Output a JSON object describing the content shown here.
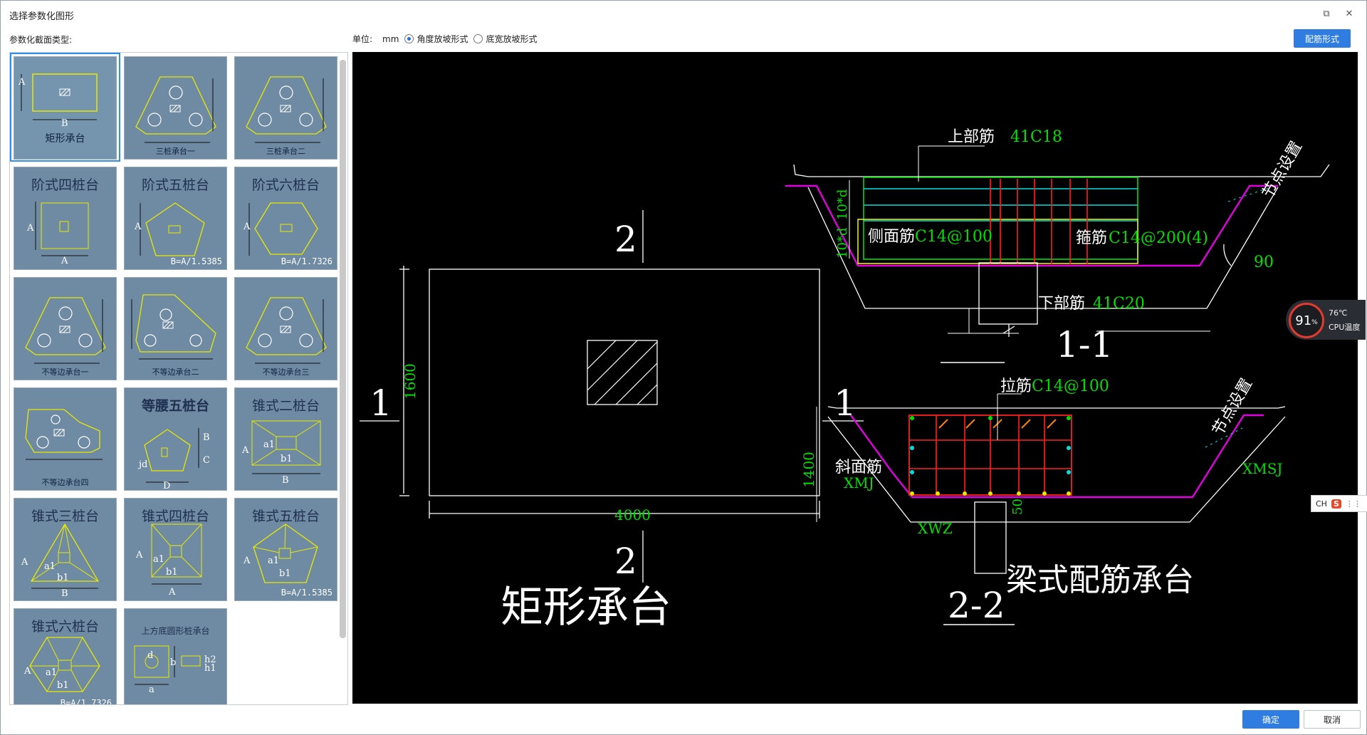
{
  "window": {
    "title": "选择参数化图形",
    "restore_icon": "restore-icon",
    "close_icon": "close-icon"
  },
  "library": {
    "label": "参数化截面类型:",
    "items": [
      {
        "name": "矩形承台",
        "selected": true
      },
      {
        "name": "三桩承台一"
      },
      {
        "name": "三桩承台二"
      },
      {
        "name": "阶式四桩台"
      },
      {
        "name": "阶式五桩台",
        "note": "B=A/1.5385"
      },
      {
        "name": "阶式六桩台",
        "note": "B=A/1.7326"
      },
      {
        "name": "不等边承台一"
      },
      {
        "name": "不等边承台二"
      },
      {
        "name": "不等边承台三"
      },
      {
        "name": "不等边承台四"
      },
      {
        "name": "等腰五桩台"
      },
      {
        "name": "锥式二桩台"
      },
      {
        "name": "锥式三桩台"
      },
      {
        "name": "锥式四桩台"
      },
      {
        "name": "锥式五桩台",
        "note": "B=A/1.5385"
      },
      {
        "name": "锥式六桩台",
        "note": "B=A/1.7326"
      },
      {
        "name": "上方底圆形桩承台"
      }
    ],
    "dim_labels": {
      "A": "A",
      "B": "B",
      "C": "C",
      "D": "D",
      "a1": "a1",
      "b1": "b1",
      "jd": "jd",
      "a": "a",
      "b": "b",
      "d": "d",
      "h1": "h1",
      "h2": "h2"
    }
  },
  "toolbar": {
    "unit_label": "单位:",
    "unit_value": "mm",
    "radio_angle": "角度放坡形式",
    "radio_width": "底宽放坡形式",
    "radio_angle_checked": true,
    "rebar_button": "配筋形式"
  },
  "drawing": {
    "plan": {
      "title": "矩形承台",
      "width_dim": "4000",
      "height_dim": "1600",
      "sec1": "1",
      "sec2": "2"
    },
    "section11": {
      "title": "1-1",
      "top_bar": "上部筋",
      "top_val": "41C18",
      "side_bar": "侧面筋",
      "side_val": "C14@100",
      "stirrup": "箍筋",
      "stirrup_val": "C14@200(4)",
      "bottom_bar": "下部筋",
      "bottom_val": "41C20",
      "node": "节点设置",
      "angle": "90",
      "d10": "10*d"
    },
    "section22": {
      "title": "2-2",
      "tie": "拉筋",
      "tie_val": "C14@100",
      "node": "节点设置",
      "slant": "斜面筋",
      "xmj": "XMJ",
      "xmsj": "XMSJ",
      "xwz": "XWZ",
      "h": "1400",
      "c": "50"
    },
    "beam_title": "梁式配筋承台"
  },
  "overlay": {
    "cpu_percent": "91",
    "pct": "%",
    "cpu_temp": "76℃",
    "cpu_label": "CPU温度",
    "ime": "CH",
    "ime_icon": "S"
  },
  "footer": {
    "ok": "确定",
    "cancel": "取消"
  },
  "colors": {
    "accent": "#2f7de1",
    "thumb_bg": "#6f8ba3",
    "cad_green": "#00e000",
    "cad_yellow": "#e8e800",
    "cad_magenta": "#e000e0",
    "cad_red": "#ff2020",
    "cad_cyan": "#00e0e0"
  }
}
